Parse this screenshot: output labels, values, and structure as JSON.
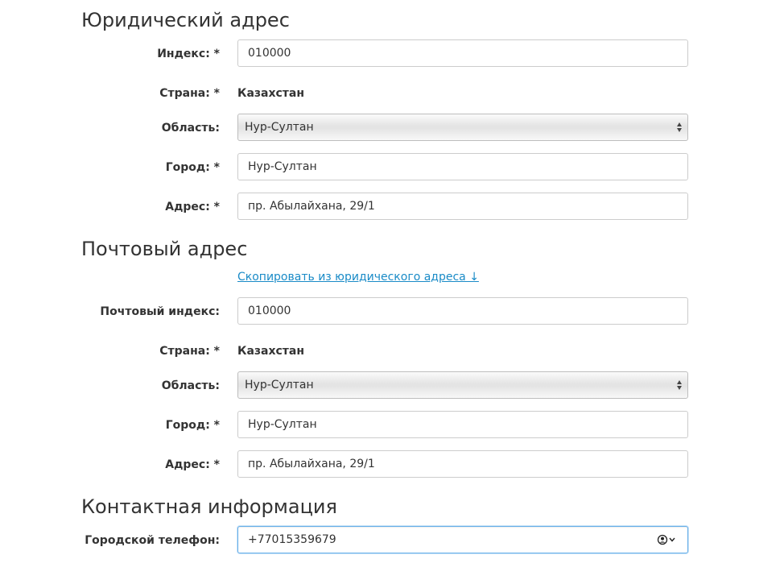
{
  "legal_address": {
    "title": "Юридический адрес",
    "index_label": "Индекс: *",
    "index_value": "010000",
    "country_label": "Страна: *",
    "country_value": "Казахстан",
    "region_label": "Область:",
    "region_value": "Нур-Султан",
    "city_label": "Город: *",
    "city_value": "Нур-Султан",
    "address_label": "Адрес: *",
    "address_value": "пр. Абылайхана, 29/1"
  },
  "postal_address": {
    "title": "Почтовый адрес",
    "copy_link": "Скопировать из юридического адреса ↓",
    "index_label": "Почтовый индекс:",
    "index_value": "010000",
    "country_label": "Страна: *",
    "country_value": "Казахстан",
    "region_label": "Область:",
    "region_value": "Нур-Султан",
    "city_label": "Город: *",
    "city_value": "Нур-Султан",
    "address_label": "Адрес: *",
    "address_value": "пр. Абылайхана, 29/1"
  },
  "contact": {
    "title": "Контактная информация",
    "city_phone_label": "Городской телефон:",
    "city_phone_value": "+77015359679"
  },
  "colors": {
    "link": "#1a8bc7",
    "focus_border": "#66afe9"
  }
}
